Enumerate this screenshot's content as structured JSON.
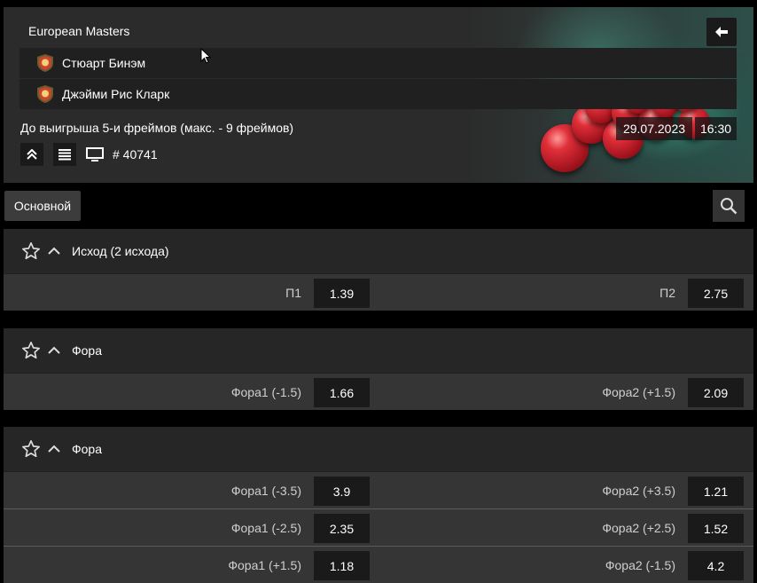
{
  "header": {
    "league": "European Masters",
    "team1": "Стюарт Бинэм",
    "team2": "Джэйми Рис Кларк",
    "condition": "До выигрыша 5-и фреймов (макс. - 9 фреймов)",
    "date": "29.07.2023",
    "time": "16:30",
    "event_id": "# 40741"
  },
  "subbar": {
    "main_tab": "Основной"
  },
  "markets": [
    {
      "title": "Исход (2 исхода)",
      "rows": [
        {
          "left_label": "П1",
          "left_odd": "1.39",
          "right_label": "П2",
          "right_odd": "2.75"
        }
      ]
    },
    {
      "title": "Фора",
      "rows": [
        {
          "left_label": "Фора1 (-1.5)",
          "left_odd": "1.66",
          "right_label": "Фора2 (+1.5)",
          "right_odd": "2.09"
        }
      ]
    },
    {
      "title": "Фора",
      "rows": [
        {
          "left_label": "Фора1 (-3.5)",
          "left_odd": "3.9",
          "right_label": "Фора2 (+3.5)",
          "right_odd": "1.21"
        },
        {
          "left_label": "Фора1 (-2.5)",
          "left_odd": "2.35",
          "right_label": "Фора2 (+2.5)",
          "right_odd": "1.52"
        },
        {
          "left_label": "Фора1 (+1.5)",
          "left_odd": "1.18",
          "right_label": "Фора2 (-1.5)",
          "right_odd": "4.2"
        }
      ]
    }
  ],
  "icons": {
    "back": "arrow-left-icon",
    "collapse": "double-chevron-up-icon",
    "stats": "list-icon",
    "tv": "monitor-icon",
    "search": "search-icon",
    "star": "star-outline-icon",
    "chevron": "chevron-up-icon"
  },
  "colors": {
    "background": "#000000",
    "panel": "#2b2b2b",
    "row": "#353535",
    "odd_box": "#1a1a1a",
    "ball": "#e0303a"
  }
}
